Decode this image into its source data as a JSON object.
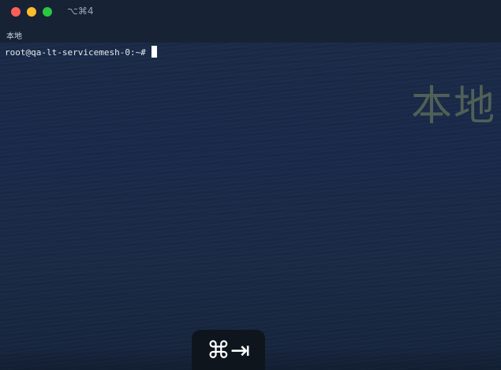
{
  "window": {
    "shortcut_label": "⌥⌘4",
    "controls": {
      "close_color": "#fe5f57",
      "minimize_color": "#febc2e",
      "maximize_color": "#28c840"
    }
  },
  "tab": {
    "label": "本地"
  },
  "terminal": {
    "prompt": "root@qa-lt-servicemesh-0:~#",
    "cursor_color": "#ffffff",
    "background_watermark": "本地"
  },
  "hud": {
    "shortcut_glyph": "⌘⇥"
  }
}
